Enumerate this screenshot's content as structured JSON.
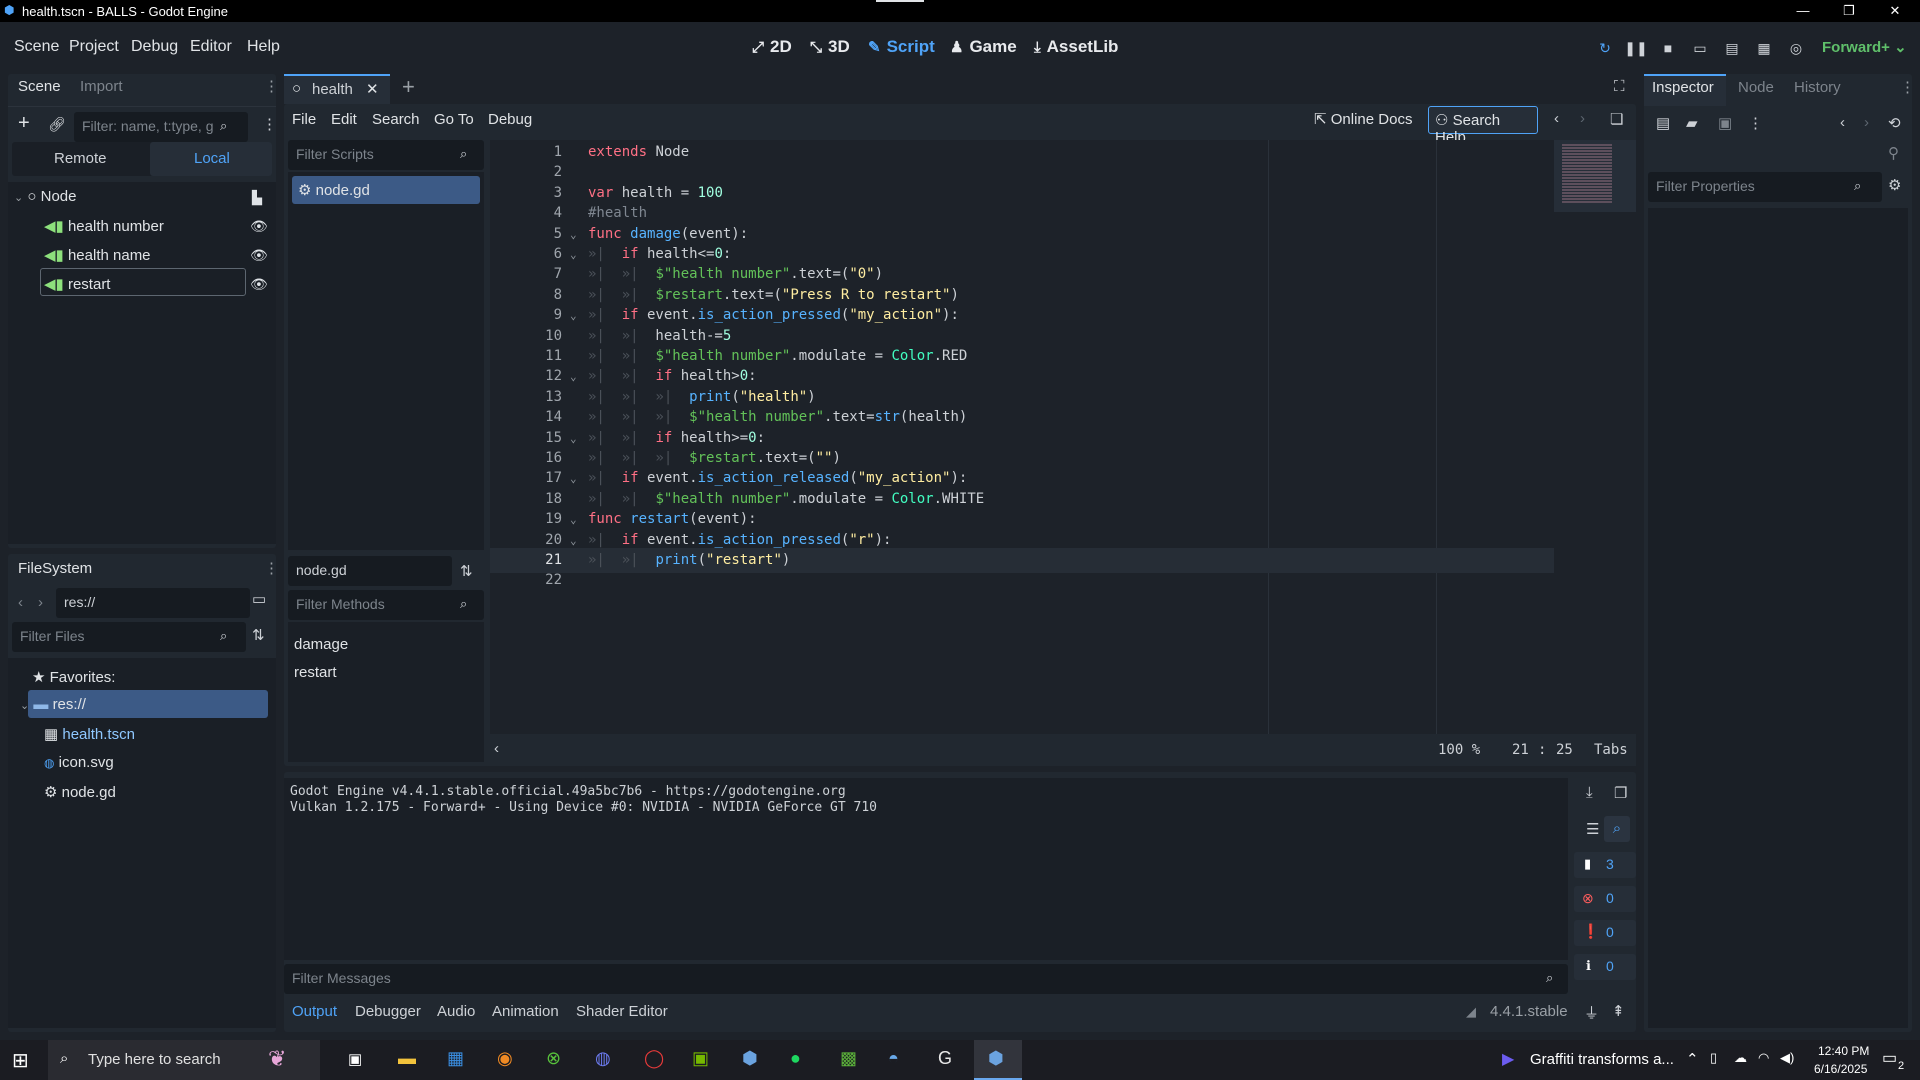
{
  "window": {
    "title": "health.tscn - BALLS - Godot Engine",
    "minimize": "—",
    "restore": "❐",
    "close": "✕"
  },
  "menubar": {
    "items": [
      "Scene",
      "Project",
      "Debug",
      "Editor",
      "Help"
    ],
    "workspaces": [
      {
        "label": "2D",
        "icon": "2d-icon"
      },
      {
        "label": "3D",
        "icon": "3d-icon"
      },
      {
        "label": "Script",
        "icon": "script-icon",
        "active": true
      },
      {
        "label": "Game",
        "icon": "game-icon"
      },
      {
        "label": "AssetLib",
        "icon": "assetlib-icon"
      }
    ],
    "renderer": "Forward+"
  },
  "scene_dock": {
    "tabs": [
      "Scene",
      "Import"
    ],
    "filter_placeholder": "Filter: name, t:type, g",
    "remote_local": [
      "Remote",
      "Local"
    ],
    "tree": [
      {
        "name": "Node"
      },
      {
        "name": "health number"
      },
      {
        "name": "health name"
      },
      {
        "name": "restart"
      }
    ]
  },
  "filesystem": {
    "title": "FileSystem",
    "path": "res://",
    "filter_placeholder": "Filter Files",
    "favorites": "Favorites:",
    "root": "res://",
    "files": [
      "health.tscn",
      "icon.svg",
      "node.gd"
    ]
  },
  "editor_tabs": {
    "tabs": [
      "health"
    ],
    "add": "+"
  },
  "script_menu": {
    "items": [
      "File",
      "Edit",
      "Search",
      "Go To",
      "Debug"
    ],
    "online_docs": "Online Docs",
    "search_help": "Search Help"
  },
  "scripts_panel": {
    "filter_placeholder": "Filter Scripts",
    "scripts": [
      "node.gd"
    ],
    "current": "node.gd",
    "methods_placeholder": "Filter Methods",
    "methods": [
      "damage",
      "restart"
    ]
  },
  "code": [
    {
      "n": "1",
      "html": "<span class='kw'>extends</span> Node"
    },
    {
      "n": "2",
      "html": ""
    },
    {
      "n": "3",
      "html": "<span class='kw'>var</span> health = <span class='num'>100</span>"
    },
    {
      "n": "4",
      "html": "<span class='com'>#health</span>"
    },
    {
      "n": "5",
      "fold": true,
      "html": "<span class='kw'>func</span> <span class='fn'>damage</span>(event):"
    },
    {
      "n": "6",
      "fold": true,
      "html": "<span class='tabch'>»|</span>  <span class='kw'>if</span> health&lt;=<span class='num'>0</span>:"
    },
    {
      "n": "7",
      "html": "<span class='tabch'>»|  »|</span>  <span class='nd'>$\"health number\"</span>.text=(<span class='str'>\"0\"</span>)"
    },
    {
      "n": "8",
      "html": "<span class='tabch'>»|  »|</span>  <span class='nd'>$restart</span>.text=(<span class='str'>\"Press R to restart\"</span>)"
    },
    {
      "n": "9",
      "fold": true,
      "html": "<span class='tabch'>»|</span>  <span class='kw'>if</span> event.<span class='fn'>is_action_pressed</span>(<span class='str'>\"my_action\"</span>):"
    },
    {
      "n": "10",
      "html": "<span class='tabch'>»|  »|</span>  health-=<span class='num'>5</span>"
    },
    {
      "n": "11",
      "html": "<span class='tabch'>»|  »|</span>  <span class='nd'>$\"health number\"</span>.modulate = <span class='cls'>Color</span>.RED"
    },
    {
      "n": "12",
      "fold": true,
      "html": "<span class='tabch'>»|  »|</span>  <span class='kw'>if</span> health&gt;<span class='num'>0</span>:"
    },
    {
      "n": "13",
      "html": "<span class='tabch'>»|  »|  »|</span>  <span class='fn'>print</span>(<span class='str'>\"health\"</span>)"
    },
    {
      "n": "14",
      "html": "<span class='tabch'>»|  »|  »|</span>  <span class='nd'>$\"health number\"</span>.text=<span class='fn'>str</span>(health)"
    },
    {
      "n": "15",
      "fold": true,
      "html": "<span class='tabch'>»|  »|</span>  <span class='kw'>if</span> health&gt;=<span class='num'>0</span>:"
    },
    {
      "n": "16",
      "html": "<span class='tabch'>»|  »|  »|</span>  <span class='nd'>$restart</span>.text=(<span class='str'>\"\"</span>)"
    },
    {
      "n": "17",
      "fold": true,
      "html": "<span class='tabch'>»|</span>  <span class='kw'>if</span> event.<span class='fn'>is_action_released</span>(<span class='str'>\"my_action\"</span>):"
    },
    {
      "n": "18",
      "html": "<span class='tabch'>»|  »|</span>  <span class='nd'>$\"health number\"</span>.modulate = <span class='cls'>Color</span>.WHITE"
    },
    {
      "n": "19",
      "fold": true,
      "html": "<span class='kw'>func</span> <span class='fn'>restart</span>(event):"
    },
    {
      "n": "20",
      "fold": true,
      "html": "<span class='tabch'>»|</span>  <span class='kw'>if</span> event.<span class='fn'>is_action_pressed</span>(<span class='str'>\"r\"</span>):"
    },
    {
      "n": "21",
      "current": true,
      "html": "<span class='tabch'>»|  »|</span>  <span class='fn'>print</span>(<span class='str'>\"restart\"</span>)"
    },
    {
      "n": "22",
      "html": ""
    }
  ],
  "status": {
    "zoom": "100 %",
    "line": "21",
    "col": "25",
    "indent": "Tabs"
  },
  "output": {
    "lines": [
      "Godot Engine v4.4.1.stable.official.49a5bc7b6 - https://godotengine.org",
      "Vulkan 1.2.175 - Forward+ - Using Device #0: NVIDIA - NVIDIA GeForce GT 710"
    ],
    "filter_placeholder": "Filter Messages",
    "counts": {
      "log": "3",
      "errors": "0",
      "warnings": "0",
      "info": "0"
    }
  },
  "bottom_tabs": [
    "Output",
    "Debugger",
    "Audio",
    "Animation",
    "Shader Editor"
  ],
  "version": "4.4.1.stable",
  "inspector": {
    "tabs": [
      "Inspector",
      "Node",
      "History"
    ],
    "filter_placeholder": "Filter Properties"
  },
  "taskbar": {
    "search_placeholder": "Type here to search",
    "news": "Graffiti transforms a...",
    "time": "12:40 PM",
    "date": "6/16/2025",
    "notifications": "2"
  },
  "colors": {
    "accent": "#4fa3f7",
    "bg": "#1d2229",
    "panel": "#212830"
  }
}
